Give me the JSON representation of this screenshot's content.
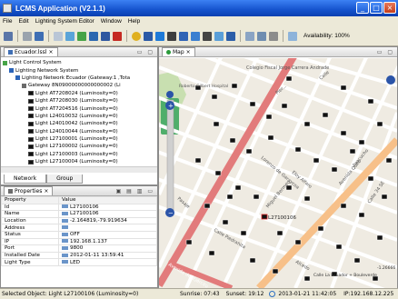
{
  "window": {
    "title": "LCMS Application (V2.1.1)"
  },
  "menu": [
    "File",
    "Edit",
    "Lighting System Editor",
    "Window",
    "Help"
  ],
  "toolbar": {
    "availability": "Availability: 100%"
  },
  "explorer": {
    "tab": "Ecuador.lssl",
    "root": "Light Control System",
    "nodes": [
      {
        "label": "Lighting Network System",
        "level": 1,
        "kind": "network"
      },
      {
        "label": "Lighting Network Ecuador  (Gateway:1 ,Tota",
        "level": 2,
        "kind": "network"
      },
      {
        "label": "Gateway 8N09000000000000002  (Li",
        "level": 3,
        "kind": "gateway"
      },
      {
        "label": "Light AT7208024  (Luminosity=0)",
        "level": 4,
        "kind": "light"
      },
      {
        "label": "Light AT7208030  (Luminosity=0)",
        "level": 4,
        "kind": "light"
      },
      {
        "label": "Light AT7204516  (Luminosity=0)",
        "level": 4,
        "kind": "light"
      },
      {
        "label": "Light L24010032  (Luminosity=0)",
        "level": 4,
        "kind": "light"
      },
      {
        "label": "Light L24010042  (Luminosity=0)",
        "level": 4,
        "kind": "light"
      },
      {
        "label": "Light L24010044  (Luminosity=0)",
        "level": 4,
        "kind": "light"
      },
      {
        "label": "Light L27100001  (Luminosity=0)",
        "level": 4,
        "kind": "light"
      },
      {
        "label": "Light L27100002  (Luminosity=0)",
        "level": 4,
        "kind": "light"
      },
      {
        "label": "Light L27100003  (Luminosity=0)",
        "level": 4,
        "kind": "light"
      },
      {
        "label": "Light L27100004  (Luminosity=0)",
        "level": 4,
        "kind": "light"
      }
    ],
    "bottom_tabs": [
      "Network",
      "Group"
    ]
  },
  "properties": {
    "tab": "Properties",
    "headers": [
      "Property",
      "Value"
    ],
    "rows": [
      [
        "Id",
        "L27100106"
      ],
      [
        "Name",
        "L27100106"
      ],
      [
        "Location",
        "-2.164819,-79.919634"
      ],
      [
        "Address",
        ""
      ],
      [
        "Status",
        "OFF"
      ],
      [
        "IP",
        "192.168.1.137"
      ],
      [
        "Port",
        "9800"
      ],
      [
        "Installed Date",
        "2012-01-11 13:59:41"
      ],
      [
        "Light Type",
        "LED"
      ]
    ]
  },
  "map": {
    "tab": "Map",
    "streets": [
      "Colegio Fiscal Jorge Carrera Andrade",
      "Calle",
      "Roberto Gilbert Hospital",
      "Pier...",
      "Lorenzo de Garaycoa",
      "Eloy Alfaro",
      "Avenida Quito",
      "Ayacucho",
      "Miguel Bermeo",
      "Calle 34 SE",
      "Alcedo",
      "Calle Piedrahita",
      "Avenida del Ejército",
      "Pasaje"
    ],
    "label_light": "L27100106",
    "attribution": "Calle La Ecuador + Bouleverde",
    "partial_coord": "-1.26666"
  },
  "status": {
    "selected": "Selected Object: Light L27100106  (Luminosity=0)",
    "sunrise": "Sunrise: 07:43",
    "sunset": "Sunset: 19:12",
    "datetime": "2013-01-21 11:42:05",
    "ip": "IP:192.168.12.225"
  }
}
